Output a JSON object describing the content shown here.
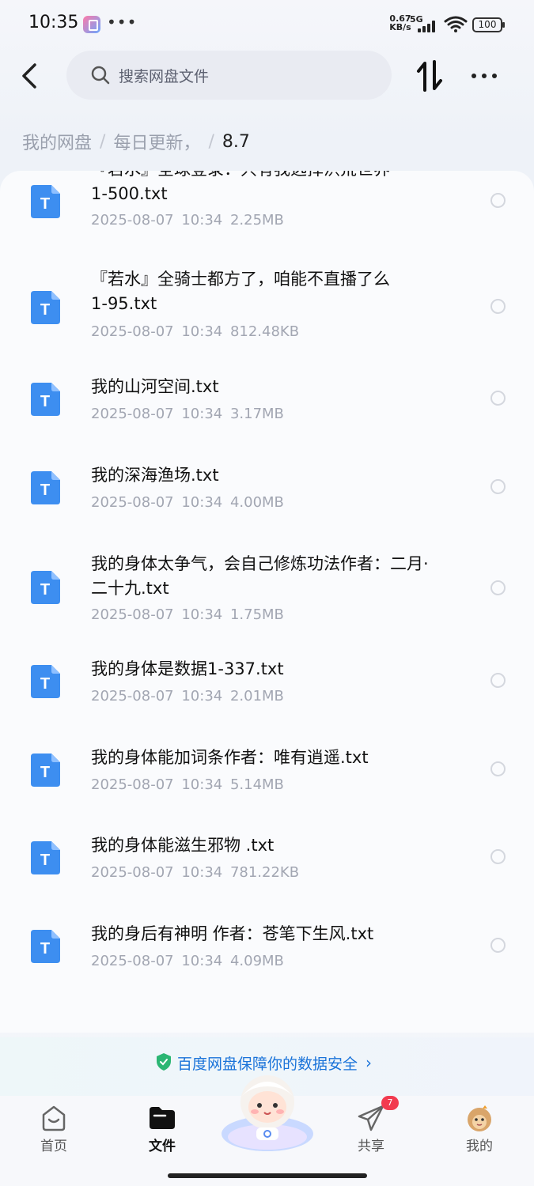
{
  "status_bar": {
    "time": "10:35",
    "dots": "•••",
    "net_speed_value": "0.67",
    "net_speed_unit": "KB/s",
    "network": "5G",
    "battery": "100"
  },
  "header": {
    "search_placeholder": "搜索网盘文件"
  },
  "breadcrumb": {
    "items": [
      "我的网盘",
      "每日更新，"
    ],
    "current": "8.7",
    "separator": "/"
  },
  "files": [
    {
      "name_line1": "『若水』全球登录：只有我选择洪荒世界",
      "name_line2": "1-500.txt",
      "date": "2025-08-07",
      "time": "10:34",
      "size": "2.25MB"
    },
    {
      "name_line1": "『若水』全骑士都方了，咱能不直播了么",
      "name_line2": "1-95.txt",
      "date": "2025-08-07",
      "time": "10:34",
      "size": "812.48KB"
    },
    {
      "name_line1": "我的山河空间.txt",
      "name_line2": "",
      "date": "2025-08-07",
      "time": "10:34",
      "size": "3.17MB"
    },
    {
      "name_line1": "我的深海渔场.txt",
      "name_line2": "",
      "date": "2025-08-07",
      "time": "10:34",
      "size": "4.00MB"
    },
    {
      "name_line1": "我的身体太争气，会自己修炼功法作者：二月·",
      "name_line2": "二十九.txt",
      "date": "2025-08-07",
      "time": "10:34",
      "size": "1.75MB"
    },
    {
      "name_line1": "我的身体是数据1-337.txt",
      "name_line2": "",
      "date": "2025-08-07",
      "time": "10:34",
      "size": "2.01MB"
    },
    {
      "name_line1": "我的身体能加词条作者：唯有逍遥.txt",
      "name_line2": "",
      "date": "2025-08-07",
      "time": "10:34",
      "size": "5.14MB"
    },
    {
      "name_line1": "我的身体能滋生邪物 .txt",
      "name_line2": "",
      "date": "2025-08-07",
      "time": "10:34",
      "size": "781.22KB"
    },
    {
      "name_line1": "我的身后有神明 作者：苍笔下生风.txt",
      "name_line2": "",
      "date": "2025-08-07",
      "time": "10:34",
      "size": "4.09MB"
    }
  ],
  "file_icon_letter": "T",
  "security_banner": {
    "text": "百度网盘保障你的数据安全",
    "arrow": "›"
  },
  "bottom_nav": {
    "home": "首页",
    "files": "文件",
    "share": "共享",
    "share_badge": "7",
    "mine": "我的"
  },
  "colors": {
    "accent": "#1a73d9",
    "file_icon": "#3d8ef0",
    "badge": "#f23b4f"
  }
}
